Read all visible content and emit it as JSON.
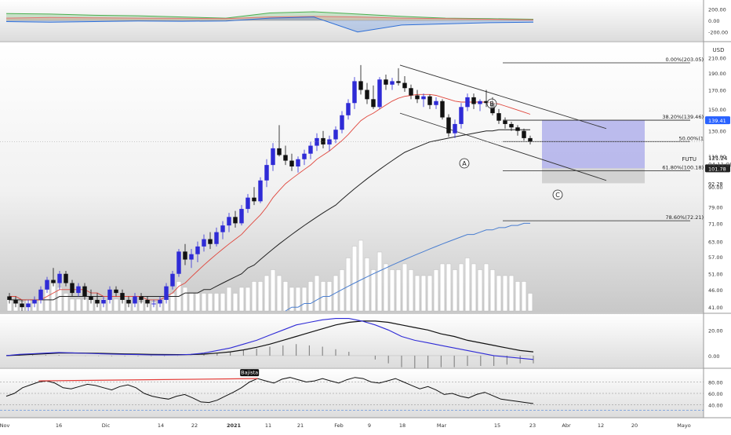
{
  "instrument": {
    "symbol": "FUTU",
    "price_label": "121.24",
    "countdown": "04:11:06",
    "currency": "USD"
  },
  "colors": {
    "up": "#2f2bd6",
    "down": "#111111",
    "ma_fast": "#e0463c",
    "ma_slow": "#222222",
    "ma_long": "#4a7ed0",
    "volume": "#ffffff",
    "fib": "#222222",
    "channel": "#333333",
    "macd": "#2f2bd6",
    "signal": "#111111",
    "rsi": "#111111",
    "trend": "#e53935",
    "box_blue": "#8a8be6",
    "box_grey": "#bdbdbd",
    "osc_green": "#4caf50",
    "osc_red": "#e57373",
    "osc_blue": "#2f6fd6",
    "price_tag_bg": "#2962ff",
    "bearish_bg": "#111111"
  },
  "chart_data": [
    {
      "type": "line",
      "name": "top-oscillator",
      "y_ticks": [
        "200.00",
        "0.00",
        "-200.00"
      ],
      "ylim": [
        -300,
        300
      ],
      "x": [
        "16",
        "Dic",
        "14",
        "22",
        "2021",
        "11",
        "21",
        "Feb",
        "9",
        "18",
        "Mar",
        "15",
        "23"
      ],
      "series": [
        {
          "values": [
            120,
            110,
            90,
            80,
            60,
            40,
            130,
            150,
            110,
            70,
            40,
            30,
            20
          ]
        },
        {
          "values": [
            40,
            50,
            45,
            40,
            35,
            30,
            60,
            70,
            60,
            40,
            30,
            20,
            10
          ]
        },
        {
          "values": [
            -20,
            -30,
            -20,
            -10,
            -15,
            -10,
            40,
            60,
            -200,
            -80,
            -60,
            -40,
            -30
          ]
        }
      ]
    },
    {
      "type": "candlestick",
      "name": "price",
      "y_ticks": [
        "210.00",
        "190.00",
        "170.00",
        "150.00",
        "130.00",
        "110.00",
        "90.00",
        "79.00",
        "71.00",
        "63.00",
        "57.00",
        "51.00",
        "46.00",
        "41.00"
      ],
      "x_ticks": [
        "Nov",
        "16",
        "Dic",
        "14",
        "22",
        "2021",
        "11",
        "21",
        "Feb",
        "9",
        "18",
        "Mar",
        "15",
        "23",
        "Abr",
        "12",
        "20",
        "Mayo"
      ],
      "last_price": 121.24,
      "price_tags": [
        {
          "label": "139.41",
          "style": "blue"
        },
        {
          "label": "121.24",
          "style": "plain"
        },
        {
          "label": "101.78",
          "style": "dark"
        },
        {
          "label": "92.28",
          "style": "plain"
        }
      ],
      "fib_levels": [
        {
          "level": "0.00%",
          "value": 203.05,
          "label": "0.00%(203.05)"
        },
        {
          "level": "38.20%",
          "value": 139.46,
          "label": "38.20%(139.46)"
        },
        {
          "level": "50.00%",
          "value": 121.24,
          "label": "50.00%(1"
        },
        {
          "level": "61.80%",
          "value": 100.18,
          "label": "61.80%(100.18)"
        },
        {
          "level": "78.60%",
          "value": 72.21,
          "label": "78.60%(72.21)"
        }
      ],
      "wave_labels": [
        "A",
        "B",
        "C"
      ],
      "box_levels": {
        "blue_top": 139.41,
        "blue_bottom": 101.78,
        "grey_bottom": 92.28
      },
      "candles": [
        {
          "o": 44,
          "h": 45,
          "l": 42,
          "c": 43
        },
        {
          "o": 43,
          "h": 44,
          "l": 41,
          "c": 42
        },
        {
          "o": 42,
          "h": 43,
          "l": 40,
          "c": 41
        },
        {
          "o": 41,
          "h": 43,
          "l": 40,
          "c": 42
        },
        {
          "o": 42,
          "h": 44,
          "l": 41,
          "c": 43
        },
        {
          "o": 43,
          "h": 47,
          "l": 42,
          "c": 46
        },
        {
          "o": 46,
          "h": 50,
          "l": 45,
          "c": 49
        },
        {
          "o": 49,
          "h": 53,
          "l": 47,
          "c": 48
        },
        {
          "o": 48,
          "h": 52,
          "l": 46,
          "c": 51
        },
        {
          "o": 51,
          "h": 52,
          "l": 47,
          "c": 48
        },
        {
          "o": 48,
          "h": 49,
          "l": 44,
          "c": 45
        },
        {
          "o": 45,
          "h": 48,
          "l": 44,
          "c": 47
        },
        {
          "o": 47,
          "h": 48,
          "l": 43,
          "c": 44
        },
        {
          "o": 44,
          "h": 46,
          "l": 42,
          "c": 43
        },
        {
          "o": 43,
          "h": 45,
          "l": 41,
          "c": 42
        },
        {
          "o": 42,
          "h": 44,
          "l": 41,
          "c": 43
        },
        {
          "o": 43,
          "h": 47,
          "l": 42,
          "c": 46
        },
        {
          "o": 46,
          "h": 47,
          "l": 44,
          "c": 45
        },
        {
          "o": 45,
          "h": 46,
          "l": 42,
          "c": 43
        },
        {
          "o": 43,
          "h": 44,
          "l": 41,
          "c": 42
        },
        {
          "o": 42,
          "h": 45,
          "l": 41,
          "c": 44
        },
        {
          "o": 44,
          "h": 45,
          "l": 42,
          "c": 43
        },
        {
          "o": 43,
          "h": 44,
          "l": 41,
          "c": 42
        },
        {
          "o": 42,
          "h": 43,
          "l": 41,
          "c": 42
        },
        {
          "o": 42,
          "h": 44,
          "l": 41,
          "c": 43
        },
        {
          "o": 43,
          "h": 48,
          "l": 42,
          "c": 47
        },
        {
          "o": 47,
          "h": 52,
          "l": 46,
          "c": 51
        },
        {
          "o": 51,
          "h": 60,
          "l": 50,
          "c": 59
        },
        {
          "o": 59,
          "h": 62,
          "l": 54,
          "c": 56
        },
        {
          "o": 56,
          "h": 60,
          "l": 53,
          "c": 58
        },
        {
          "o": 58,
          "h": 63,
          "l": 55,
          "c": 61
        },
        {
          "o": 61,
          "h": 66,
          "l": 59,
          "c": 64
        },
        {
          "o": 64,
          "h": 67,
          "l": 60,
          "c": 62
        },
        {
          "o": 62,
          "h": 69,
          "l": 61,
          "c": 67
        },
        {
          "o": 67,
          "h": 72,
          "l": 64,
          "c": 70
        },
        {
          "o": 70,
          "h": 76,
          "l": 67,
          "c": 74
        },
        {
          "o": 74,
          "h": 77,
          "l": 69,
          "c": 71
        },
        {
          "o": 71,
          "h": 80,
          "l": 70,
          "c": 78
        },
        {
          "o": 78,
          "h": 86,
          "l": 76,
          "c": 84
        },
        {
          "o": 84,
          "h": 90,
          "l": 80,
          "c": 82
        },
        {
          "o": 82,
          "h": 96,
          "l": 81,
          "c": 94
        },
        {
          "o": 94,
          "h": 108,
          "l": 90,
          "c": 104
        },
        {
          "o": 104,
          "h": 120,
          "l": 100,
          "c": 116
        },
        {
          "o": 116,
          "h": 135,
          "l": 110,
          "c": 111
        },
        {
          "o": 111,
          "h": 118,
          "l": 104,
          "c": 107
        },
        {
          "o": 107,
          "h": 112,
          "l": 100,
          "c": 103
        },
        {
          "o": 103,
          "h": 110,
          "l": 99,
          "c": 108
        },
        {
          "o": 108,
          "h": 115,
          "l": 104,
          "c": 112
        },
        {
          "o": 112,
          "h": 121,
          "l": 108,
          "c": 118
        },
        {
          "o": 118,
          "h": 128,
          "l": 114,
          "c": 124
        },
        {
          "o": 124,
          "h": 130,
          "l": 116,
          "c": 119
        },
        {
          "o": 119,
          "h": 126,
          "l": 114,
          "c": 123
        },
        {
          "o": 123,
          "h": 134,
          "l": 120,
          "c": 131
        },
        {
          "o": 131,
          "h": 148,
          "l": 128,
          "c": 144
        },
        {
          "o": 144,
          "h": 160,
          "l": 140,
          "c": 156
        },
        {
          "o": 156,
          "h": 185,
          "l": 150,
          "c": 180
        },
        {
          "o": 180,
          "h": 200,
          "l": 165,
          "c": 170
        },
        {
          "o": 170,
          "h": 178,
          "l": 155,
          "c": 160
        },
        {
          "o": 160,
          "h": 175,
          "l": 150,
          "c": 152
        },
        {
          "o": 152,
          "h": 185,
          "l": 150,
          "c": 182
        },
        {
          "o": 182,
          "h": 188,
          "l": 170,
          "c": 176
        },
        {
          "o": 176,
          "h": 184,
          "l": 170,
          "c": 180
        },
        {
          "o": 180,
          "h": 196,
          "l": 175,
          "c": 178
        },
        {
          "o": 178,
          "h": 186,
          "l": 168,
          "c": 172
        },
        {
          "o": 172,
          "h": 176,
          "l": 160,
          "c": 164
        },
        {
          "o": 164,
          "h": 170,
          "l": 156,
          "c": 160
        },
        {
          "o": 160,
          "h": 166,
          "l": 152,
          "c": 163
        },
        {
          "o": 163,
          "h": 165,
          "l": 150,
          "c": 154
        },
        {
          "o": 154,
          "h": 162,
          "l": 150,
          "c": 158
        },
        {
          "o": 158,
          "h": 160,
          "l": 140,
          "c": 142
        },
        {
          "o": 142,
          "h": 145,
          "l": 125,
          "c": 128
        },
        {
          "o": 128,
          "h": 140,
          "l": 124,
          "c": 136
        },
        {
          "o": 136,
          "h": 156,
          "l": 132,
          "c": 152
        },
        {
          "o": 152,
          "h": 166,
          "l": 148,
          "c": 162
        },
        {
          "o": 162,
          "h": 166,
          "l": 150,
          "c": 155
        },
        {
          "o": 155,
          "h": 160,
          "l": 148,
          "c": 158
        },
        {
          "o": 158,
          "h": 170,
          "l": 152,
          "c": 156
        },
        {
          "o": 156,
          "h": 162,
          "l": 144,
          "c": 146
        },
        {
          "o": 146,
          "h": 150,
          "l": 136,
          "c": 139
        },
        {
          "o": 139,
          "h": 142,
          "l": 132,
          "c": 136
        },
        {
          "o": 136,
          "h": 138,
          "l": 130,
          "c": 133
        },
        {
          "o": 133,
          "h": 135,
          "l": 126,
          "c": 130
        },
        {
          "o": 130,
          "h": 132,
          "l": 122,
          "c": 124
        },
        {
          "o": 124,
          "h": 126,
          "l": 119,
          "c": 121.24
        }
      ],
      "ma_fast": [
        44,
        44,
        43,
        43,
        43,
        43,
        44,
        45,
        46,
        46,
        46,
        46,
        46,
        45,
        45,
        44,
        44,
        44,
        44,
        44,
        44,
        44,
        43,
        43,
        43,
        44,
        45,
        47,
        48,
        50,
        52,
        54,
        56,
        58,
        60,
        62,
        64,
        66,
        69,
        72,
        75,
        79,
        84,
        88,
        92,
        95,
        98,
        101,
        104,
        108,
        111,
        114,
        118,
        122,
        127,
        133,
        139,
        143,
        146,
        150,
        154,
        158,
        161,
        163,
        164,
        165,
        165,
        165,
        164,
        162,
        160,
        158,
        157,
        157,
        157,
        157,
        157,
        156,
        155,
        153,
        151,
        149,
        147,
        145
      ],
      "ma_slow": [
        43,
        43,
        43,
        43,
        43,
        43,
        43,
        43,
        44,
        44,
        44,
        44,
        44,
        44,
        44,
        44,
        44,
        44,
        44,
        44,
        44,
        44,
        44,
        44,
        44,
        44,
        44,
        44,
        45,
        45,
        45,
        46,
        46,
        47,
        48,
        49,
        50,
        51,
        53,
        54,
        56,
        58,
        60,
        62,
        64,
        66,
        68,
        70,
        72,
        74,
        76,
        78,
        80,
        83,
        86,
        89,
        92,
        95,
        98,
        101,
        104,
        107,
        110,
        113,
        115,
        117,
        119,
        121,
        122,
        123,
        124,
        125,
        126,
        127,
        128,
        129,
        130,
        130,
        131,
        131,
        131,
        131,
        131,
        131
      ],
      "ma_long_start_index": 44,
      "ma_long": [
        40,
        41,
        41,
        42,
        42,
        43,
        44,
        44,
        45,
        46,
        47,
        48,
        49,
        50,
        51,
        52,
        53,
        54,
        55,
        56,
        57,
        58,
        59,
        60,
        61,
        62,
        63,
        64,
        65,
        66,
        66,
        67,
        68,
        68,
        69,
        69,
        70,
        70,
        71,
        71
      ],
      "volume": [
        2,
        2,
        1.5,
        2,
        2,
        3,
        4,
        5,
        4,
        3,
        2,
        2,
        2,
        2,
        1.5,
        2,
        3,
        2,
        2,
        1.5,
        2,
        1.5,
        1.5,
        1.5,
        1.5,
        2,
        3,
        5,
        4,
        3,
        3,
        3,
        3,
        3,
        3,
        4,
        3,
        4,
        4,
        5,
        5,
        6,
        7,
        6,
        5,
        4,
        4,
        4,
        5,
        6,
        5,
        5,
        6,
        7,
        9,
        11,
        12,
        9,
        7,
        10,
        8,
        7,
        7,
        8,
        7,
        6,
        6,
        6,
        7,
        8,
        8,
        7,
        8,
        9,
        8,
        7,
        8,
        7,
        6,
        6,
        6,
        5,
        5,
        3
      ]
    },
    {
      "type": "line",
      "name": "macd",
      "y_ticks": [
        "20.00",
        "0.00"
      ],
      "ylim": [
        -8,
        30
      ],
      "series": [
        {
          "values": [
            0,
            1,
            1.5,
            2,
            2.5,
            2.2,
            1.8,
            1.5,
            1.2,
            1,
            0.8,
            0.6,
            0.5,
            0.6,
            1,
            2,
            4,
            6,
            9,
            12,
            16,
            20,
            24,
            26,
            28,
            29,
            29,
            27,
            24,
            20,
            15,
            12,
            10,
            8,
            6,
            4,
            2,
            0,
            -1,
            -2,
            -3
          ]
        },
        {
          "values": [
            0,
            0.5,
            1,
            1.5,
            2,
            2.1,
            2,
            1.8,
            1.6,
            1.4,
            1.2,
            1,
            0.9,
            0.8,
            0.9,
            1.2,
            2,
            3,
            4.5,
            6.5,
            9,
            12,
            15,
            18,
            21,
            24,
            26,
            27,
            27,
            26,
            24,
            22,
            20,
            17,
            15,
            12,
            10,
            8,
            6,
            4,
            3
          ]
        }
      ],
      "histogram": [
        0,
        0.5,
        0.5,
        0.5,
        0.5,
        0.1,
        -0.2,
        -0.3,
        -0.4,
        -0.4,
        -0.4,
        -0.4,
        -0.4,
        -0.2,
        0.1,
        0.8,
        2,
        3,
        4.5,
        5.5,
        7,
        8,
        9,
        8,
        7,
        5,
        3,
        0,
        -3,
        -6,
        -9,
        -10,
        -10,
        -9,
        -9,
        -8,
        -8,
        -8,
        -7,
        -6,
        -6
      ]
    },
    {
      "type": "line",
      "name": "rsi",
      "y_ticks": [
        "80.00",
        "60.00",
        "40.00"
      ],
      "ylim": [
        20,
        100
      ],
      "badge": "Bajista",
      "series": [
        {
          "values": [
            55,
            60,
            70,
            75,
            80,
            82,
            78,
            70,
            68,
            72,
            76,
            74,
            70,
            66,
            72,
            75,
            70,
            60,
            55,
            52,
            50,
            55,
            58,
            52,
            45,
            44,
            48,
            55,
            62,
            70,
            80,
            86,
            82,
            78,
            85,
            88,
            84,
            80,
            82,
            86,
            82,
            78,
            84,
            88,
            86,
            80,
            78,
            82,
            86,
            80,
            74,
            68,
            72,
            66,
            58,
            60,
            55,
            52,
            58,
            62,
            56,
            50,
            48,
            46,
            44,
            42
          ]
        }
      ]
    }
  ]
}
